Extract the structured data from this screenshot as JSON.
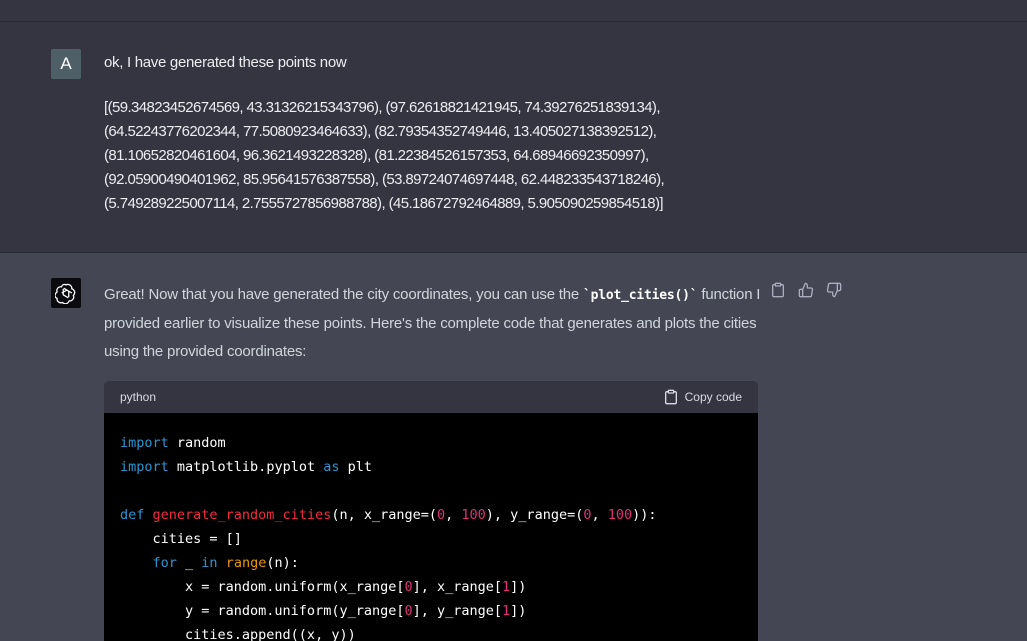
{
  "user_message": {
    "avatar_letter": "A",
    "intro": "ok, I have generated these points now",
    "points_text": "[(59.34823452674569, 43.31326215343796), (97.62618821421945, 74.39276251839134),\n(64.52243776202344, 77.5080923464633), (82.79354352749446, 13.405027138392512),\n(81.10652820461604, 96.3621493228328), (81.22384526157353, 64.68946692350997),\n(92.05900490401962, 85.95641576387558), (53.89724074697448, 62.448233543718246),\n(5.749289225007114, 2.7555727856988788), (45.18672792464889, 5.905090259854518)]"
  },
  "assistant_message": {
    "text_before_code": "Great! Now that you have generated the city coordinates, you can use the ",
    "inline_code": "`plot_cities()`",
    "text_after_code": " function I provided earlier to visualize these points. Here's the complete code that generates and plots the cities using the provided coordinates:",
    "actions": [
      "clipboard-icon",
      "thumbs-up-icon",
      "thumbs-down-icon"
    ]
  },
  "code_block": {
    "language": "python",
    "copy_label": "Copy code",
    "lines": [
      [
        {
          "t": "import",
          "c": "kw"
        },
        {
          "t": " random",
          "c": ""
        }
      ],
      [
        {
          "t": "import",
          "c": "kw"
        },
        {
          "t": " matplotlib.pyplot ",
          "c": ""
        },
        {
          "t": "as",
          "c": "kw"
        },
        {
          "t": " plt",
          "c": ""
        }
      ],
      [],
      [
        {
          "t": "def ",
          "c": "kw"
        },
        {
          "t": "generate_random_cities",
          "c": "fn"
        },
        {
          "t": "(n, x_range=(",
          "c": ""
        },
        {
          "t": "0",
          "c": "num"
        },
        {
          "t": ", ",
          "c": ""
        },
        {
          "t": "100",
          "c": "num"
        },
        {
          "t": "), y_range=(",
          "c": ""
        },
        {
          "t": "0",
          "c": "num"
        },
        {
          "t": ", ",
          "c": ""
        },
        {
          "t": "100",
          "c": "num"
        },
        {
          "t": ")):",
          "c": ""
        }
      ],
      [
        {
          "t": "    cities = []",
          "c": ""
        }
      ],
      [
        {
          "t": "    ",
          "c": ""
        },
        {
          "t": "for",
          "c": "kw"
        },
        {
          "t": " _ ",
          "c": ""
        },
        {
          "t": "in",
          "c": "kw"
        },
        {
          "t": " ",
          "c": ""
        },
        {
          "t": "range",
          "c": "bi"
        },
        {
          "t": "(n):",
          "c": ""
        }
      ],
      [
        {
          "t": "        x = random.uniform(x_range[",
          "c": ""
        },
        {
          "t": "0",
          "c": "num"
        },
        {
          "t": "], x_range[",
          "c": ""
        },
        {
          "t": "1",
          "c": "num"
        },
        {
          "t": "])",
          "c": ""
        }
      ],
      [
        {
          "t": "        y = random.uniform(y_range[",
          "c": ""
        },
        {
          "t": "0",
          "c": "num"
        },
        {
          "t": "], y_range[",
          "c": ""
        },
        {
          "t": "1",
          "c": "num"
        },
        {
          "t": "])",
          "c": ""
        }
      ],
      [
        {
          "t": "        cities.append((x, y))",
          "c": ""
        }
      ]
    ]
  },
  "colors": {
    "page_bg": "#444654",
    "user_bg": "#343541",
    "keyword": "#2e95d3",
    "function": "#f22c3d",
    "number": "#df3079",
    "builtin": "#e9950c"
  }
}
